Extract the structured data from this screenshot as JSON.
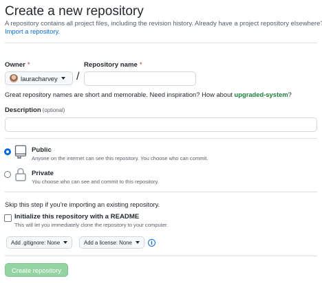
{
  "header": {
    "title": "Create a new repository",
    "subtitle": "A repository contains all project files, including the revision history. Already have a project repository elsewhere?",
    "import_link": "Import a repository."
  },
  "owner": {
    "label": "Owner",
    "required_mark": "*",
    "selected": "lauracharvey"
  },
  "separator": "/",
  "repo_name": {
    "label": "Repository name",
    "required_mark": "*",
    "value": ""
  },
  "hint": {
    "text": "Great repository names are short and memorable. Need inspiration? How about ",
    "suggestion": "upgraded-system",
    "suffix": "?"
  },
  "description": {
    "label": "Description",
    "optional": "(optional)",
    "value": ""
  },
  "visibility": {
    "public": {
      "label": "Public",
      "description": "Anyone on the internet can see this repository. You choose who can commit.",
      "checked": true
    },
    "private": {
      "label": "Private",
      "description": "You choose who can see and commit to this repository.",
      "checked": false
    }
  },
  "init": {
    "skip_text": "Skip this step if you're importing an existing repository.",
    "readme_label": "Initialize this repository with a README",
    "readme_desc": "This will let you immediately clone the repository to your computer.",
    "readme_checked": false,
    "gitignore_label": "Add .gitignore: None",
    "license_label": "Add a license: None"
  },
  "submit": {
    "label": "Create repository"
  },
  "colors": {
    "accent": "#0969da",
    "required": "#cf222e",
    "suggestion": "#1a7f37",
    "create_button_disabled": "#94d3a2"
  },
  "icons": {
    "public": "repo-public-icon",
    "private": "lock-icon",
    "info": "info-icon",
    "dropdown": "caret-down-icon"
  }
}
